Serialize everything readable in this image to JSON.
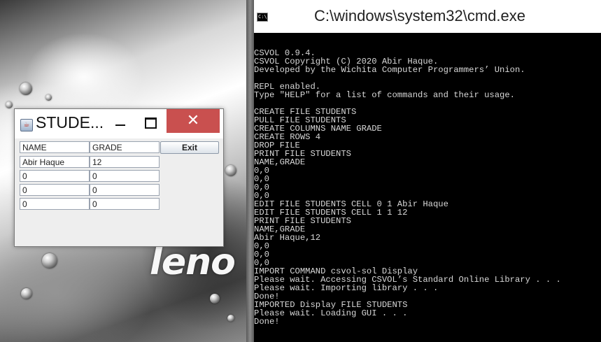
{
  "desktop": {
    "brand_text": "leno"
  },
  "student_window": {
    "title": "STUDE...",
    "close_glyph": "✕",
    "exit_label": "Exit",
    "headers": [
      "NAME",
      "GRADE"
    ],
    "rows": [
      [
        "Abir Haque",
        "12"
      ],
      [
        "0",
        "0"
      ],
      [
        "0",
        "0"
      ],
      [
        "0",
        "0"
      ]
    ]
  },
  "cmd_window": {
    "title": "C:\\windows\\system32\\cmd.exe",
    "icon_text": "C:\\",
    "lines": [
      "CSVOL 0.9.4.",
      "CSVOL Copyright (C) 2020 Abir Haque.",
      "Developed by the Wichita Computer Programmers’ Union.",
      "",
      "REPL enabled.",
      "Type \"HELP\" for a list of commands and their usage.",
      "",
      "CREATE FILE STUDENTS",
      "PULL FILE STUDENTS",
      "CREATE COLUMNS NAME GRADE",
      "CREATE ROWS 4",
      "DROP FILE",
      "PRINT FILE STUDENTS",
      "NAME,GRADE",
      "0,0",
      "0,0",
      "0,0",
      "0,0",
      "EDIT FILE STUDENTS CELL 0 1 Abir Haque",
      "EDIT FILE STUDENTS CELL 1 1 12",
      "PRINT FILE STUDENTS",
      "NAME,GRADE",
      "Abir Haque,12",
      "0,0",
      "0,0",
      "0,0",
      "IMPORT COMMAND csvol-sol Display",
      "Please wait. Accessing CSVOL’s Standard Online Library . . .",
      "Please wait. Importing library . . .",
      "Done!",
      "IMPORTED Display FILE STUDENTS",
      "Please wait. Loading GUI . . .",
      "Done!"
    ]
  }
}
